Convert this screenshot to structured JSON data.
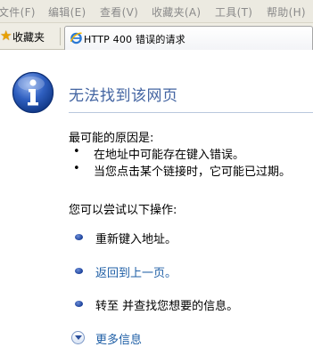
{
  "menubar": {
    "items": [
      "文件(F)",
      "编辑(E)",
      "查看(V)",
      "收藏夹(A)",
      "工具(T)",
      "帮助(H)"
    ]
  },
  "favorites": {
    "label": "收藏夹"
  },
  "tab": {
    "title": "HTTP 400 错误的请求"
  },
  "page": {
    "heading": "无法找到该网页",
    "causes_title": "最可能的原因是:",
    "causes": [
      "在地址中可能存在键入错误。",
      "当您点击某个链接时，它可能已过期。"
    ],
    "try_title": "您可以尝试以下操作:",
    "actions": [
      "重新键入地址。",
      "返回到上一页。",
      "转至   并查找您想要的信息。"
    ],
    "more_info": "更多信息"
  },
  "colors": {
    "heading": "#4465a2",
    "link": "#1f5fa6"
  }
}
